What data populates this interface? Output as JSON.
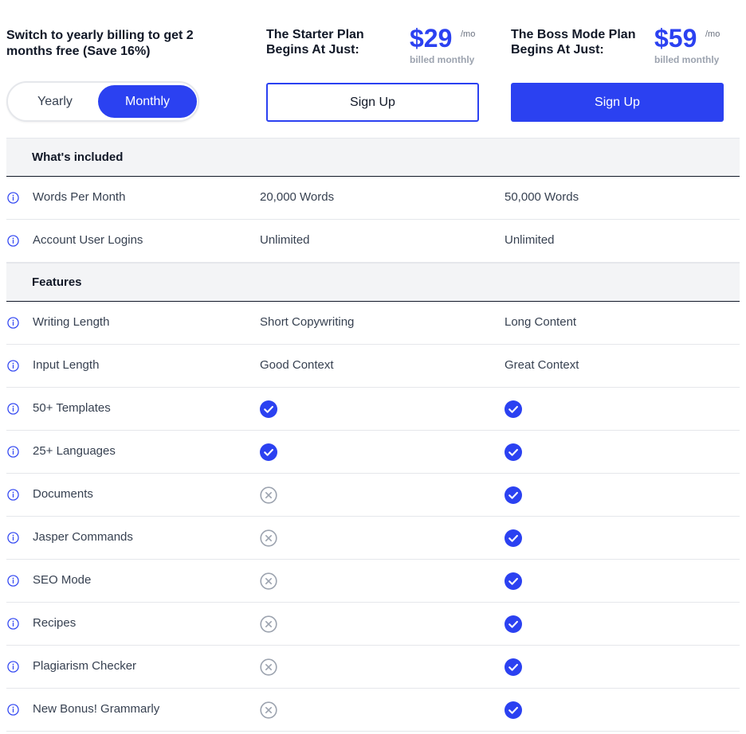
{
  "promo": {
    "text": "Switch to yearly billing to get 2 months free (Save 16%)"
  },
  "billing_toggle": {
    "yearly_label": "Yearly",
    "monthly_label": "Monthly",
    "selected": "Monthly"
  },
  "plans": [
    {
      "title": "The Starter Plan Begins At Just:",
      "price": "$29",
      "per": "/mo",
      "billed": "billed monthly",
      "cta": "Sign Up",
      "style": "outline"
    },
    {
      "title": "The Boss Mode Plan Begins At Just:",
      "price": "$59",
      "per": "/mo",
      "billed": "billed monthly",
      "cta": "Sign Up",
      "style": "filled"
    }
  ],
  "sections": [
    {
      "title": "What's included",
      "rows": [
        {
          "label": "Words Per Month",
          "starter": "20,000 Words",
          "boss": "50,000 Words"
        },
        {
          "label": "Account User Logins",
          "starter": "Unlimited",
          "boss": "Unlimited"
        }
      ]
    },
    {
      "title": "Features",
      "rows": [
        {
          "label": "Writing Length",
          "starter": "Short Copywriting",
          "boss": "Long Content"
        },
        {
          "label": "Input Length",
          "starter": "Good Context",
          "boss": "Great Context"
        },
        {
          "label": "50+ Templates",
          "starter": "check",
          "boss": "check"
        },
        {
          "label": "25+ Languages",
          "starter": "check",
          "boss": "check"
        },
        {
          "label": "Documents",
          "starter": "cross",
          "boss": "check"
        },
        {
          "label": "Jasper Commands",
          "starter": "cross",
          "boss": "check"
        },
        {
          "label": "SEO Mode",
          "starter": "cross",
          "boss": "check"
        },
        {
          "label": "Recipes",
          "starter": "cross",
          "boss": "check"
        },
        {
          "label": "Plagiarism Checker",
          "starter": "cross",
          "boss": "check"
        },
        {
          "label": "New Bonus! Grammarly",
          "starter": "cross",
          "boss": "check"
        }
      ]
    }
  ],
  "icons": {
    "info": "info-circle-icon",
    "check": "check-circle-icon",
    "cross": "x-circle-icon"
  },
  "colors": {
    "accent": "#2b41f1",
    "muted": "#9ca3af",
    "section_bg": "#f3f4f6"
  }
}
